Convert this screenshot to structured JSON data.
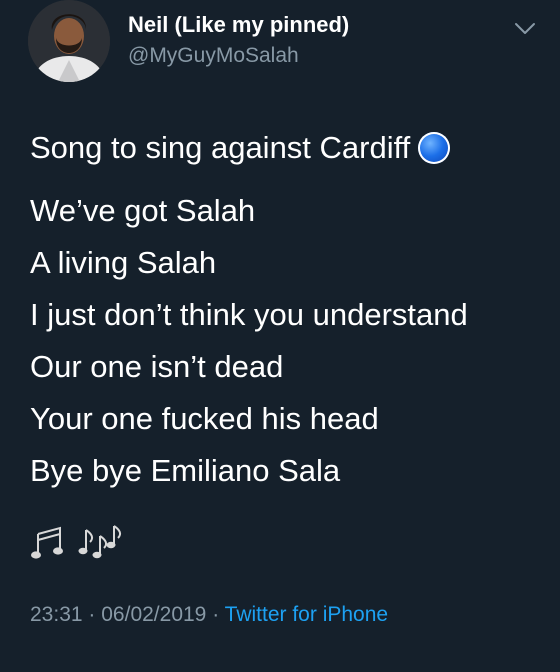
{
  "author": {
    "display_name": "Neil (Like my pinned)",
    "handle": "@MyGuyMoSalah",
    "avatar_icon": "profile-photo"
  },
  "tweet": {
    "intro": "Song to sing against Cardiff",
    "intro_emoji": "blue-circle-emoji",
    "lyrics": [
      "We’ve got Salah",
      "A living Salah",
      "I just don’t think you understand",
      "Our one isn’t dead",
      "Your one fucked his head",
      "Bye bye Emiliano Sala"
    ],
    "trailing_emoji": "musical-notes-emoji"
  },
  "meta": {
    "time": "23:31",
    "separator": "·",
    "date": "06/02/2019",
    "source": "Twitter for iPhone"
  },
  "colors": {
    "background": "#15202b",
    "text": "#ffffff",
    "secondary": "#8899a6",
    "link": "#1da1f2"
  },
  "icons": {
    "menu": "chevron-down-icon"
  }
}
